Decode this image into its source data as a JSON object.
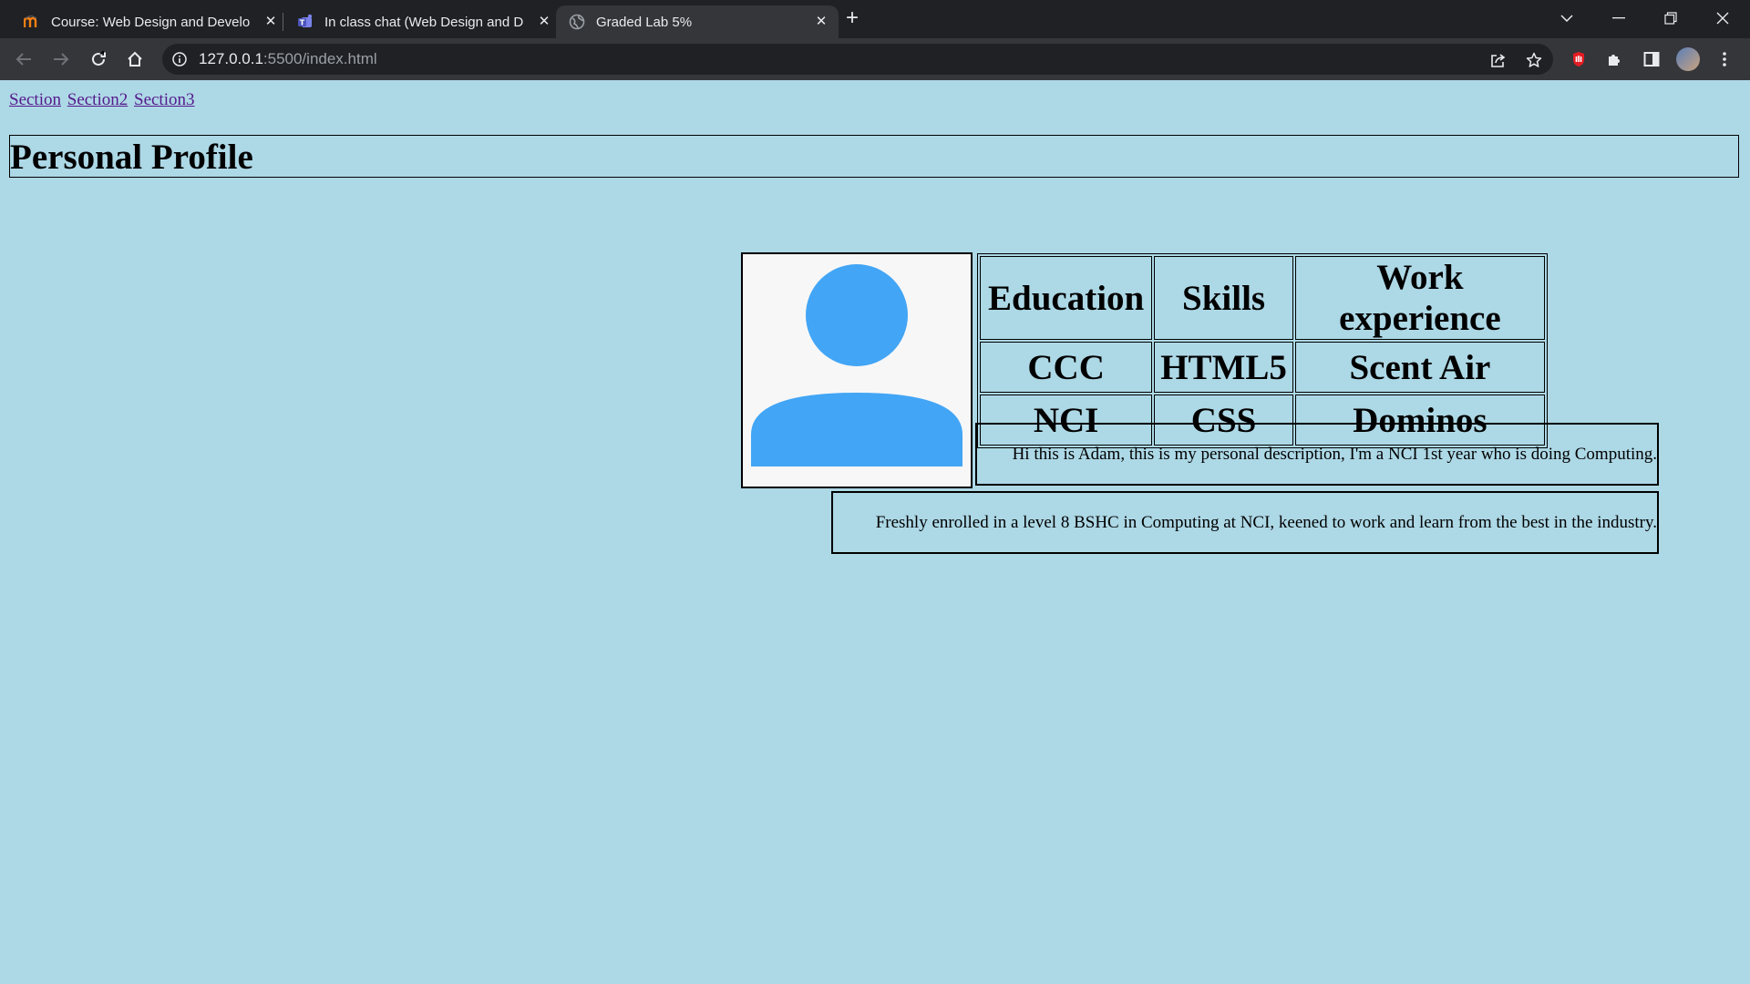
{
  "browser": {
    "tabs": [
      {
        "title": "Course: Web Design and Develop",
        "favicon": "moodle-icon"
      },
      {
        "title": "In class chat (Web Design and De",
        "favicon": "teams-icon"
      },
      {
        "title": "Graded Lab 5%",
        "favicon": "globe-icon",
        "active": true
      }
    ],
    "url_host": "127.0.0.1",
    "url_rest": ":5500/index.html"
  },
  "page": {
    "nav_links": [
      "Section",
      "Section2",
      "Section3"
    ],
    "title": "Personal Profile",
    "table": {
      "headers": [
        "Education",
        "Skills",
        "Work experience"
      ],
      "rows": [
        [
          "CCC",
          "HTML5",
          "Scent Air"
        ],
        [
          "NCI",
          "CSS",
          "Dominos"
        ]
      ]
    },
    "description_1": "Hi this is Adam, this is my personal description, I'm a NCI 1st year who is doing Computing.",
    "description_2": "Freshly enrolled in a level 8 BSHC in Computing at NCI, keened to work and learn from the best in the industry."
  },
  "colors": {
    "page_background": "#add8e6",
    "avatar_blue": "#42a5f5",
    "link_visited": "#551a8b"
  }
}
